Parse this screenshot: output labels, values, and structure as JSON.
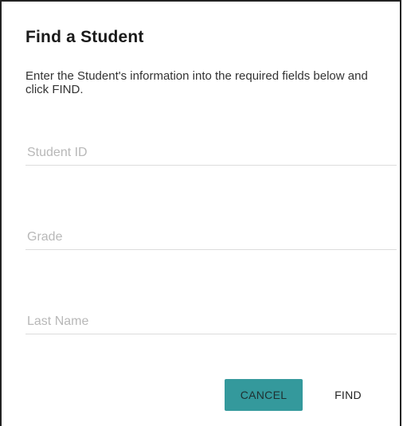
{
  "dialog": {
    "title": "Find a Student",
    "description": "Enter the Student's information into the required fields below and click FIND."
  },
  "fields": {
    "student_id": {
      "placeholder": "Student ID",
      "value": ""
    },
    "grade": {
      "placeholder": "Grade",
      "value": ""
    },
    "last_name": {
      "placeholder": "Last Name",
      "value": ""
    }
  },
  "actions": {
    "cancel_label": "CANCEL",
    "find_label": "FIND"
  },
  "colors": {
    "accent": "#34999c",
    "border": "#222222",
    "underline": "#dcdcdc"
  }
}
